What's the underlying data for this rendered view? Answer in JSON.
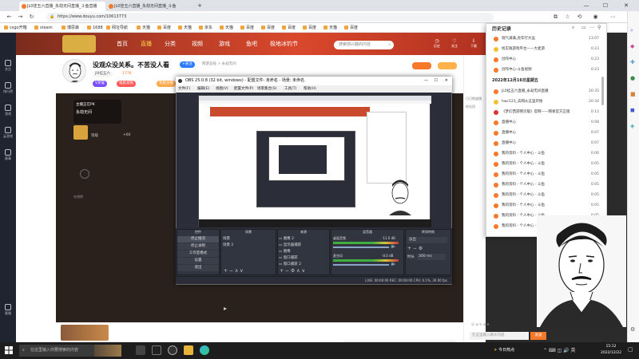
{
  "browser": {
    "tabs": [
      {
        "label": "JL0挂五六直播_永劫无间直播_斗鱼直播"
      },
      {
        "label": "JL0挂五六直播_永劫无间直播_斗鱼"
      }
    ],
    "new_tab": "+",
    "win_controls": {
      "min": "—",
      "max": "☐",
      "close": "✕"
    },
    "url": "https://www.douyu.com/10613773",
    "bookmarks": [
      "csgo开箱",
      "steam",
      "博思森",
      "1688",
      "网址导航",
      "天猫",
      "百度",
      "天猫",
      "京东",
      "天猫",
      "百度",
      "百度",
      "百度",
      "百度",
      "天猫",
      "百度"
    ]
  },
  "site": {
    "nav": [
      "首页",
      "直播",
      "分类",
      "视频",
      "游戏",
      "鱼吧",
      "极地冰钓节"
    ],
    "search_placeholder": "搜索感兴趣的内容",
    "header_icons": [
      "历史",
      "关注",
      "下载"
    ],
    "login": "登录"
  },
  "sidebar": {
    "items": [
      "关注",
      "排行榜",
      "游戏",
      "云游戏",
      "赛事",
      "客服"
    ]
  },
  "room": {
    "title": "没观众没关系。不苦没人看",
    "tag_follow": "+关注",
    "category": "网游竞技 > 永劫无间",
    "anchor": "jl0挂五六",
    "hot": "1776",
    "rank_label": "V荣誉",
    "badges": [
      "福星高照",
      "星级主播"
    ],
    "video_caption_1": "主播正在PK",
    "video_caption_2": "永劫无间",
    "video_label_3": "等级",
    "video_label_4": "+60",
    "video_label_5": "在线榜",
    "chat_label": "日日熊盛播",
    "chat_label_2": "粉丝团",
    "footer_input": "在这里输入聊天内容",
    "footer_send": "发送"
  },
  "obs": {
    "title": "OBS 25.0.8 (32 bit, windows) - 配置文件: 未命名 - 场景: 未命名",
    "menu": [
      "文件(F)",
      "编辑(E)",
      "视图(V)",
      "配置文件(P)",
      "场景集合(S)",
      "工具(T)",
      "帮助(H)"
    ],
    "docks": [
      "控件",
      "场景",
      "来源",
      "混音器",
      "转场特效"
    ],
    "controls": [
      "停止推流",
      "停止录制",
      "工作室模式",
      "设置",
      "退出"
    ],
    "scenes": [
      "场景",
      "场景 2"
    ],
    "sources": [
      "图像 2",
      "显示器捕获",
      "图像",
      "窗口捕获",
      "窗口捕获 2"
    ],
    "mixer": [
      {
        "name": "桌面音频",
        "db": "-11.0 dB"
      },
      {
        "name": "麦克风",
        "db": "-0.0 dB"
      }
    ],
    "transition": {
      "label": "淡出",
      "duration_label": "时长",
      "duration": "300 ms"
    },
    "status": "LIVE: 00:00:00   REC: 00:00:00   CPU: 0.1%, 30.00 fps"
  },
  "history": {
    "title": "历史记录",
    "items": [
      {
        "text": "瑞气满满,虎年行大运",
        "time": "13:07"
      },
      {
        "text": "找实践游戏平台——大麦游",
        "time": "0:23"
      },
      {
        "text": "创作中心",
        "time": "0:23"
      },
      {
        "text": "创作中心-斗鱼视频",
        "time": "0:23"
      }
    ],
    "date": "2022年12月16日星期五",
    "items2": [
      {
        "text": "JL0挂五六直播_永劫无间直播",
        "time": "20:35"
      },
      {
        "text": "hwc123_去网从这里开始",
        "time": "20:34"
      },
      {
        "text": "《梦幻西游网页版》官网——网易官方正版",
        "time": "0:12"
      },
      {
        "text": "直播中心",
        "time": "0:08"
      },
      {
        "text": "直播中心",
        "time": "0:07"
      },
      {
        "text": "直播中心",
        "time": "0:07"
      },
      {
        "text": "我的资料 - 个人中心 - 斗鱼",
        "time": "0:06"
      },
      {
        "text": "我的资料 - 个人中心 - 斗鱼",
        "time": "0:05"
      },
      {
        "text": "我的资料 - 个人中心 - 斗鱼",
        "time": "0:05"
      },
      {
        "text": "我的资料 - 个人中心 - 斗鱼",
        "time": "0:05"
      },
      {
        "text": "我的资料 - 个人中心 - 斗鱼",
        "time": "0:05"
      },
      {
        "text": "我的资料 - 个人中心 - 斗鱼",
        "time": "0:05"
      },
      {
        "text": "我的资料 - 个人中心 - 斗鱼",
        "time": "0:05"
      },
      {
        "text": "我的资料 - 个人中心 - 斗鱼",
        "time": "0:05"
      },
      {
        "text": "我的资料 - 个人中心 - 斗鱼",
        "time": "0:05"
      },
      {
        "text": "我的资料 - 个人中心 - 斗鱼",
        "time": "0:05"
      },
      {
        "text": "我的资料 - 个人中心 - 斗鱼",
        "time": "0:05"
      }
    ]
  },
  "taskbar": {
    "search_placeholder": "在这里输入你要搜索的内容",
    "weather": "今日热点",
    "time": "15:12",
    "date": "2022/12/22"
  },
  "colors": {
    "douyu_orange": "#f6782a",
    "banner_red": "#c23a24",
    "obs_bg": "#2b2e38"
  }
}
